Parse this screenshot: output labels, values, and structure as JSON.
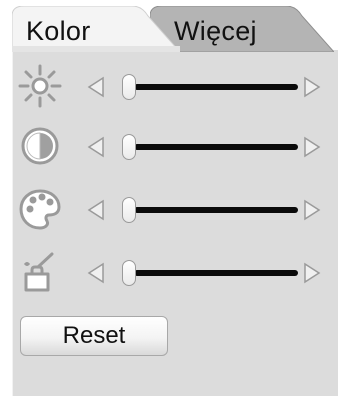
{
  "tabs": [
    {
      "label": "Kolor",
      "active": true
    },
    {
      "label": "Więcej",
      "active": false
    }
  ],
  "sliders": [
    {
      "icon": "brightness-icon",
      "value": 0.0
    },
    {
      "icon": "contrast-icon",
      "value": 0.0
    },
    {
      "icon": "color-palette-icon",
      "value": 0.0
    },
    {
      "icon": "paint-bucket-icon",
      "value": 0.0
    }
  ],
  "buttons": {
    "reset_label": "Reset"
  },
  "colors": {
    "panel_background": "#dcdcdc",
    "active_tab": "#f4f4f4",
    "inactive_tab": "#b4b4b4",
    "track": "#0a0a0a",
    "icon": "#9a9a9a"
  }
}
